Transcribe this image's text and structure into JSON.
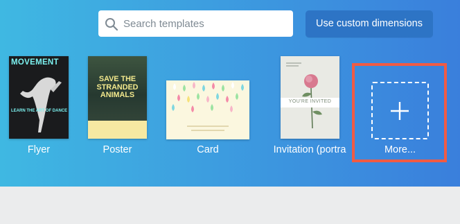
{
  "search": {
    "placeholder": "Search templates",
    "icon": "search-icon"
  },
  "custom_dimensions_label": "Use custom dimensions",
  "templates": [
    {
      "label": "Flyer",
      "thumb_title": "MOVEMENT",
      "thumb_text": "LEARN THE ART OF DANCE"
    },
    {
      "label": "Poster",
      "thumb_title": "SAVE THE STRANDED ANIMALS"
    },
    {
      "label": "Card"
    },
    {
      "label": "Invitation (portra",
      "thumb_title": "YOU'RE INVITED"
    }
  ],
  "more": {
    "label": "More...",
    "icon": "plus-icon"
  },
  "colors": {
    "hero_gradient_start": "#3fb8e2",
    "hero_gradient_end": "#3a7fdc",
    "button": "#2d74c5",
    "highlight_border": "#f05b44",
    "footer": "#ebeced"
  }
}
